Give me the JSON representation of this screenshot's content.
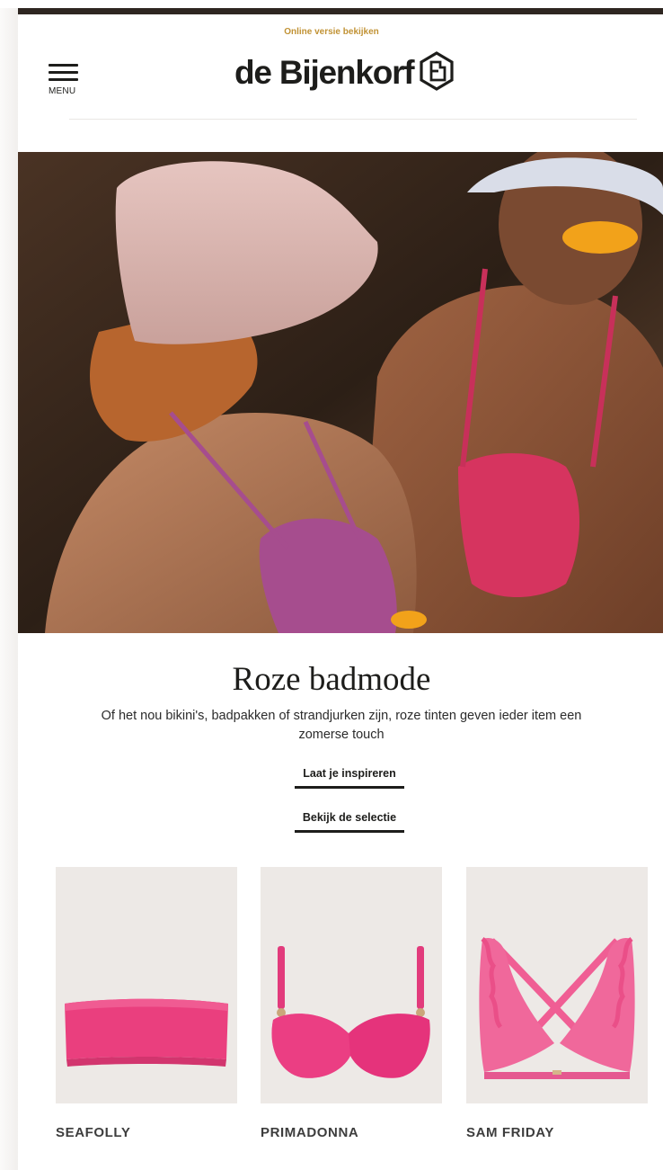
{
  "header": {
    "online_link": "Online versie bekijken",
    "menu_label": "MENU",
    "logo_text": "de Bijenkorf"
  },
  "hero": {
    "image": "hero-beach-photo"
  },
  "main": {
    "headline": "Roze badmode",
    "subtext": "Of het nou bikini's, badpakken of strandjurken zijn, roze tinten geven ieder item een zomerse touch",
    "cta_primary": "Laat je inspireren",
    "cta_secondary": "Bekijk de selectie"
  },
  "products": [
    {
      "brand": "SEAFOLLY",
      "image": "pink-bandeau-top"
    },
    {
      "brand": "PRIMADONNA",
      "image": "pink-underwire-bra-top"
    },
    {
      "brand": "SAM FRIDAY",
      "image": "pink-ruffle-bikini-top"
    }
  ],
  "colors": {
    "accent": "#c19234",
    "text": "#1d1d1b",
    "product_bg": "#ede9e6",
    "pink": "#ea3f7e"
  }
}
